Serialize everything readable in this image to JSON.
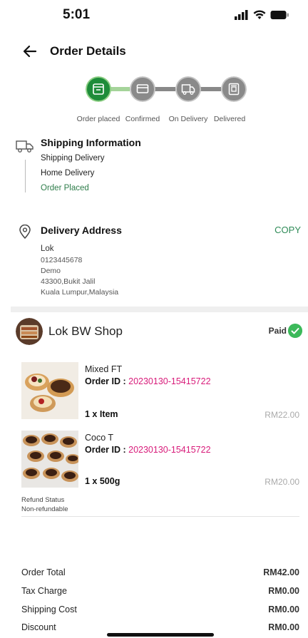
{
  "status_bar": {
    "time": "5:01"
  },
  "header": {
    "title": "Order Details"
  },
  "progress": {
    "steps": [
      {
        "label": "Order placed",
        "active": true
      },
      {
        "label": "Confirmed",
        "active": false
      },
      {
        "label": "On Delivery",
        "active": false
      },
      {
        "label": "Delivered",
        "active": false
      }
    ]
  },
  "shipping": {
    "title": "Shipping Information",
    "method": "Shipping Delivery",
    "type": "Home Delivery",
    "status": "Order Placed"
  },
  "address": {
    "title": "Delivery Address",
    "copy_label": "COPY",
    "name": "Lok",
    "phone": "0123445678",
    "line1": "Demo",
    "line2": "43300,Bukit Jalil",
    "line3": "Kuala Lumpur,Malaysia"
  },
  "shop": {
    "name": "Lok BW Shop",
    "payment_status": "Paid"
  },
  "items": [
    {
      "name": "Mixed FT",
      "order_label": "Order ID : ",
      "order_id": "20230130-15415722",
      "qty": "1 x Item",
      "price": "RM22.00"
    },
    {
      "name": "Coco T",
      "order_label": "Order ID : ",
      "order_id": "20230130-15415722",
      "qty": "1 x 500g",
      "price": "RM20.00"
    }
  ],
  "refund": {
    "label": "Refund Status",
    "value": "Non-refundable"
  },
  "summary": [
    {
      "label": "Order Total",
      "value": "RM42.00"
    },
    {
      "label": "Tax Charge",
      "value": "RM0.00"
    },
    {
      "label": "Shipping Cost",
      "value": "RM0.00"
    },
    {
      "label": "Discount",
      "value": "RM0.00"
    }
  ],
  "colors": {
    "accent_green": "#2e8b57",
    "active_step": "#1e8c3a",
    "order_id": "#d81b7a",
    "inactive_step": "#8a8a8a"
  }
}
